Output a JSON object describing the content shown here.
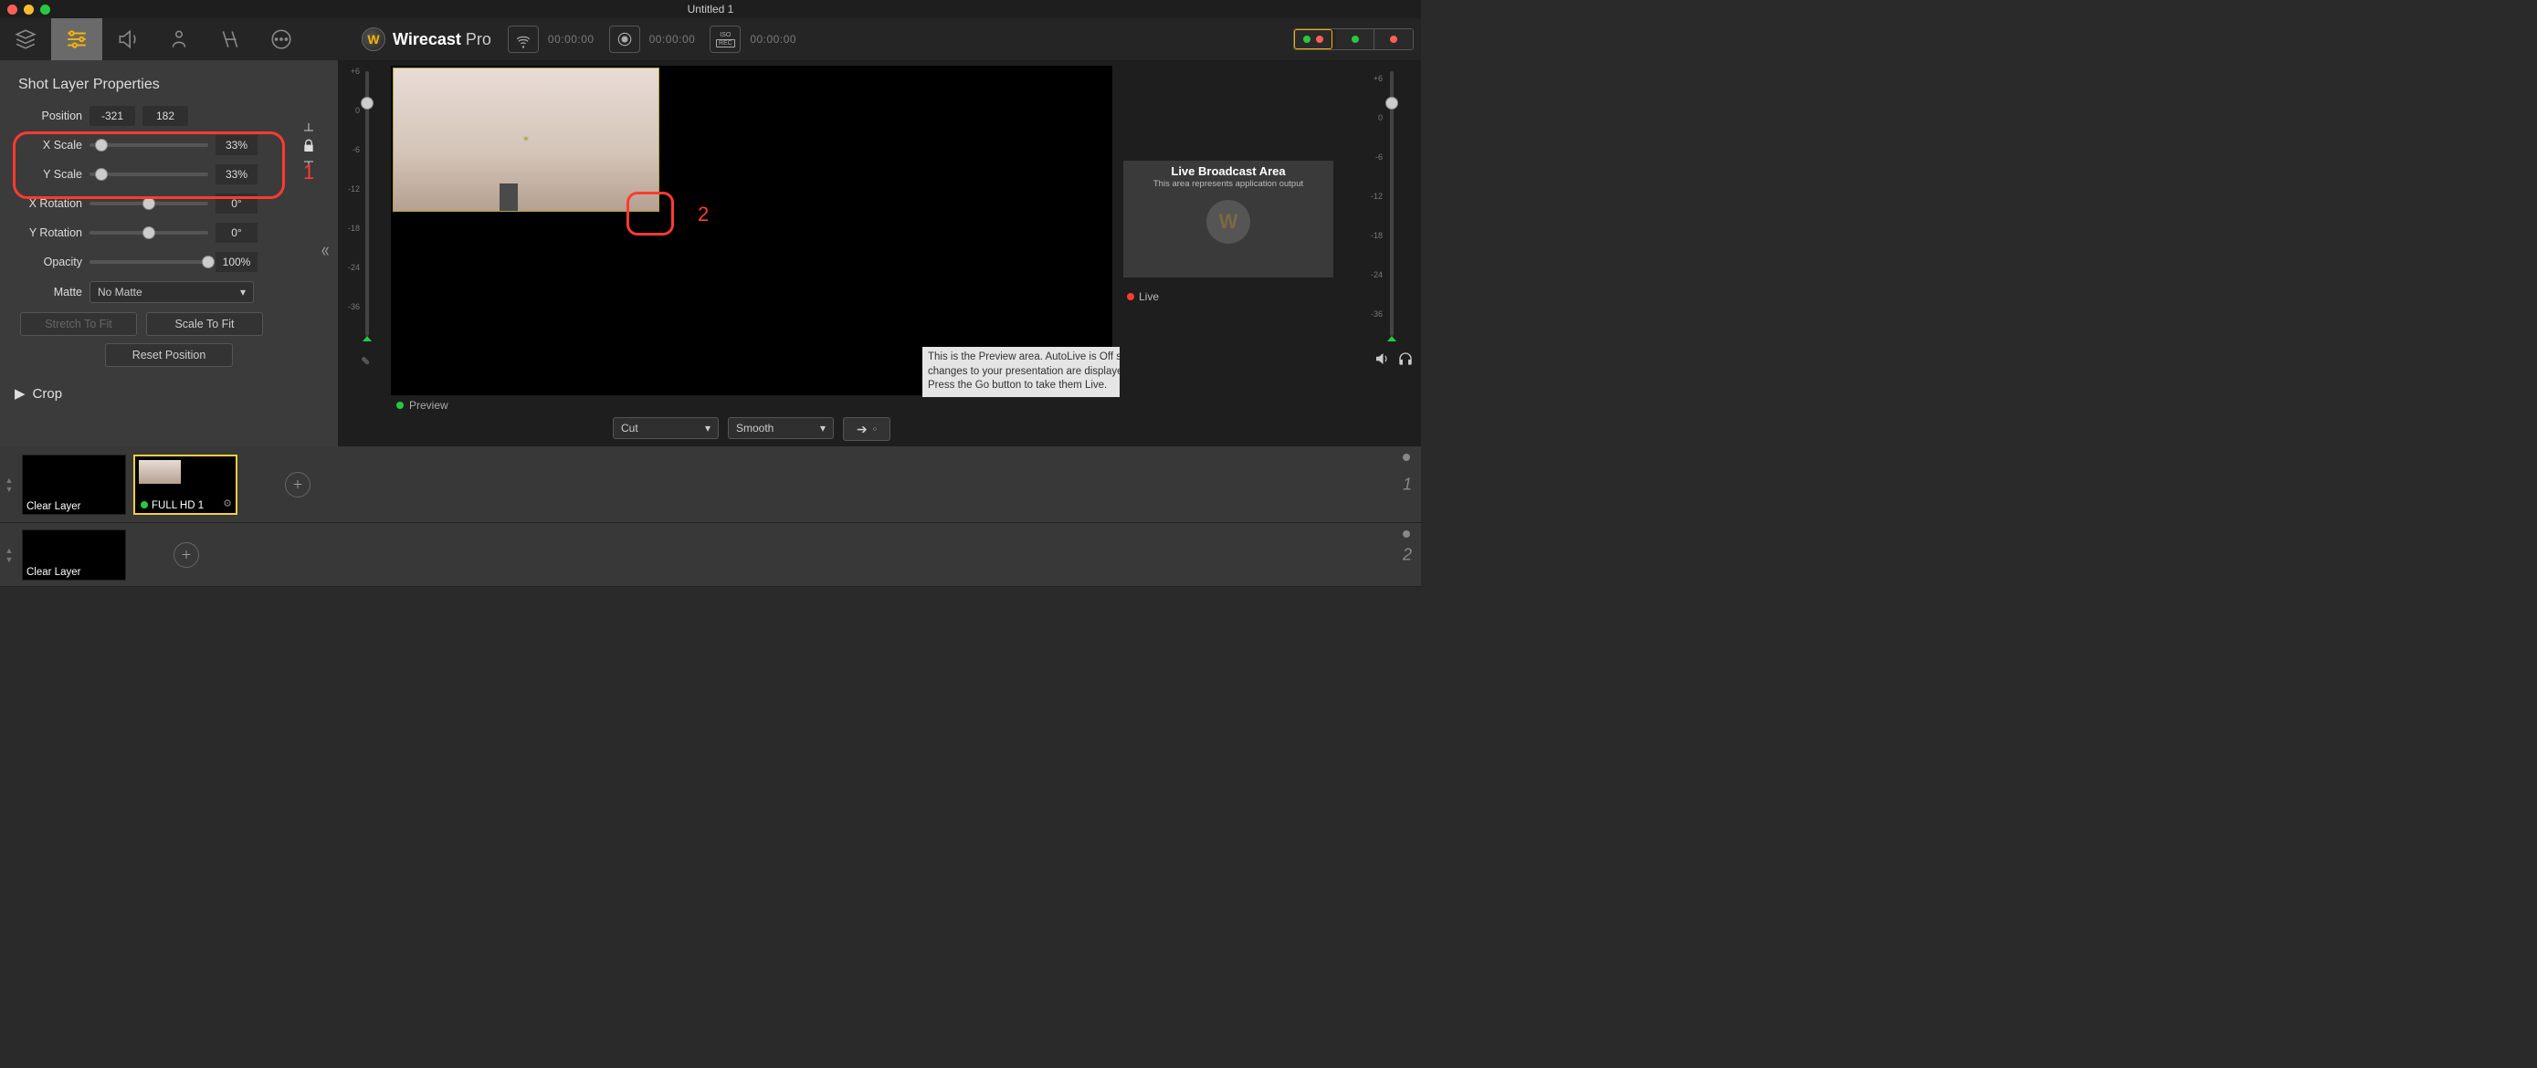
{
  "window": {
    "title": "Untitled 1"
  },
  "brand": {
    "name_bold": "Wirecast",
    "name_light": " Pro"
  },
  "timecodes": {
    "stream": "00:00:00",
    "record": "00:00:00",
    "iso": "00:00:00"
  },
  "panel": {
    "title": "Shot Layer Properties",
    "position_label": "Position",
    "position_x": "-321",
    "position_y": "182",
    "x_scale_label": "X Scale",
    "x_scale_value": "33%",
    "y_scale_label": "Y Scale",
    "y_scale_value": "33%",
    "x_rot_label": "X Rotation",
    "x_rot_value": "0°",
    "y_rot_label": "Y Rotation",
    "y_rot_value": "0°",
    "opacity_label": "Opacity",
    "opacity_value": "100%",
    "matte_label": "Matte",
    "matte_value": "No Matte",
    "stretch_btn": "Stretch To Fit",
    "scale_btn": "Scale To Fit",
    "reset_btn": "Reset Position",
    "crop_label": "Crop"
  },
  "meter_labels": [
    "+6",
    "0",
    "-6",
    "-12",
    "-18",
    "-24",
    "-36"
  ],
  "preview": {
    "label": "Preview",
    "tooltip": "This is the Preview area.  AutoLive is Off so changes to your presentation are displayed here.  Press the Go button to take them Live."
  },
  "transitions": {
    "cut": "Cut",
    "smooth": "Smooth"
  },
  "live_area": {
    "title": "Live Broadcast Area",
    "subtitle": "This area represents application output",
    "label": "Live"
  },
  "layers": {
    "clear_label": "Clear Layer",
    "shot1_label": "FULL HD 1",
    "row1_num": "1",
    "row2_num": "2"
  },
  "annotations": {
    "one": "1",
    "two": "2"
  }
}
